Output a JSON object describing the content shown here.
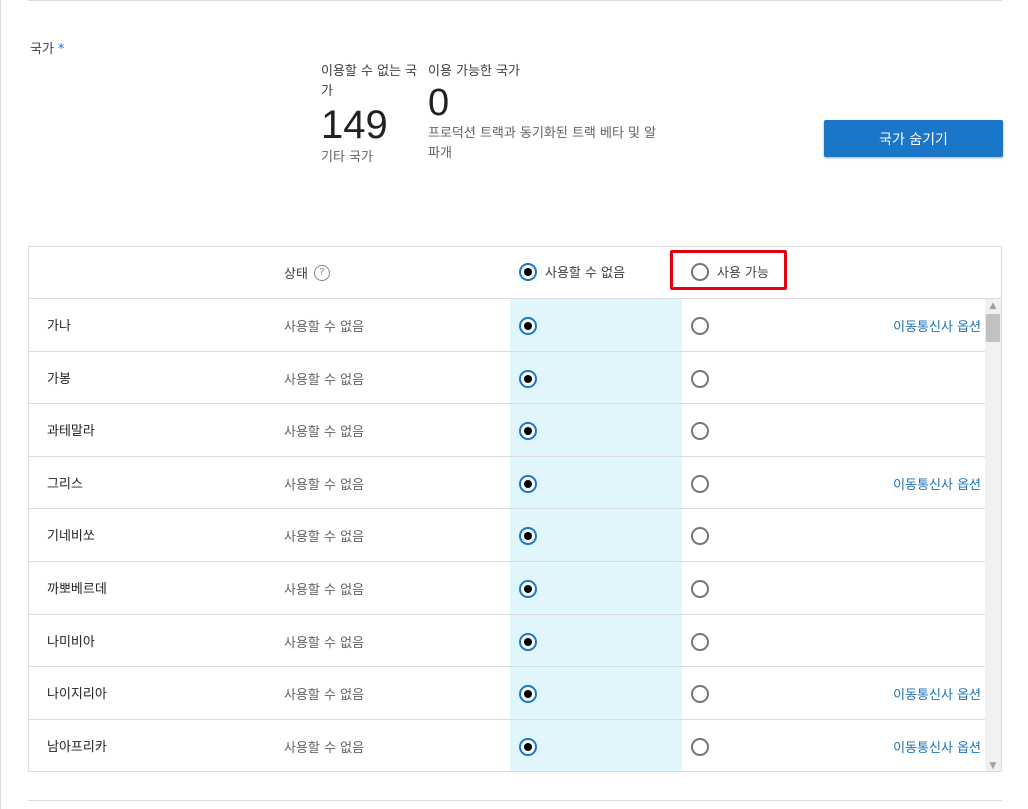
{
  "country_field": {
    "label": "국가",
    "required_mark": "*"
  },
  "stats": {
    "unavailable": {
      "label": "이용할 수 없는 국가",
      "count": "149",
      "sub": "기타 국가"
    },
    "available": {
      "label": "이용 가능한 국가",
      "count": "0",
      "sub": "프로덕션 트랙과 동기화된 트랙 베타 및 알파개"
    }
  },
  "hide_button": {
    "label": "국가 숨기기"
  },
  "table": {
    "header": {
      "status_label": "상태",
      "help_icon": "?",
      "unavailable_label": "사용할 수 없음",
      "available_label": "사용 가능"
    },
    "rows": [
      {
        "name": "가나",
        "status": "사용할 수 없음",
        "carrier": "이동통신사 옵션"
      },
      {
        "name": "가봉",
        "status": "사용할 수 없음",
        "carrier": ""
      },
      {
        "name": "과테말라",
        "status": "사용할 수 없음",
        "carrier": ""
      },
      {
        "name": "그리스",
        "status": "사용할 수 없음",
        "carrier": "이동통신사 옵션"
      },
      {
        "name": "기네비쏘",
        "status": "사용할 수 없음",
        "carrier": ""
      },
      {
        "name": "까뽀베르데",
        "status": "사용할 수 없음",
        "carrier": ""
      },
      {
        "name": "나미비아",
        "status": "사용할 수 없음",
        "carrier": ""
      },
      {
        "name": "나이지리아",
        "status": "사용할 수 없음",
        "carrier": "이동통신사 옵션"
      },
      {
        "name": "남아프리카",
        "status": "사용할 수 없음",
        "carrier": "이동통신사 옵션"
      }
    ]
  },
  "colors": {
    "accent": "#1976c8",
    "link": "#1b72b8",
    "highlight": "#e3000f",
    "column_bg": "#e1f5fd"
  }
}
